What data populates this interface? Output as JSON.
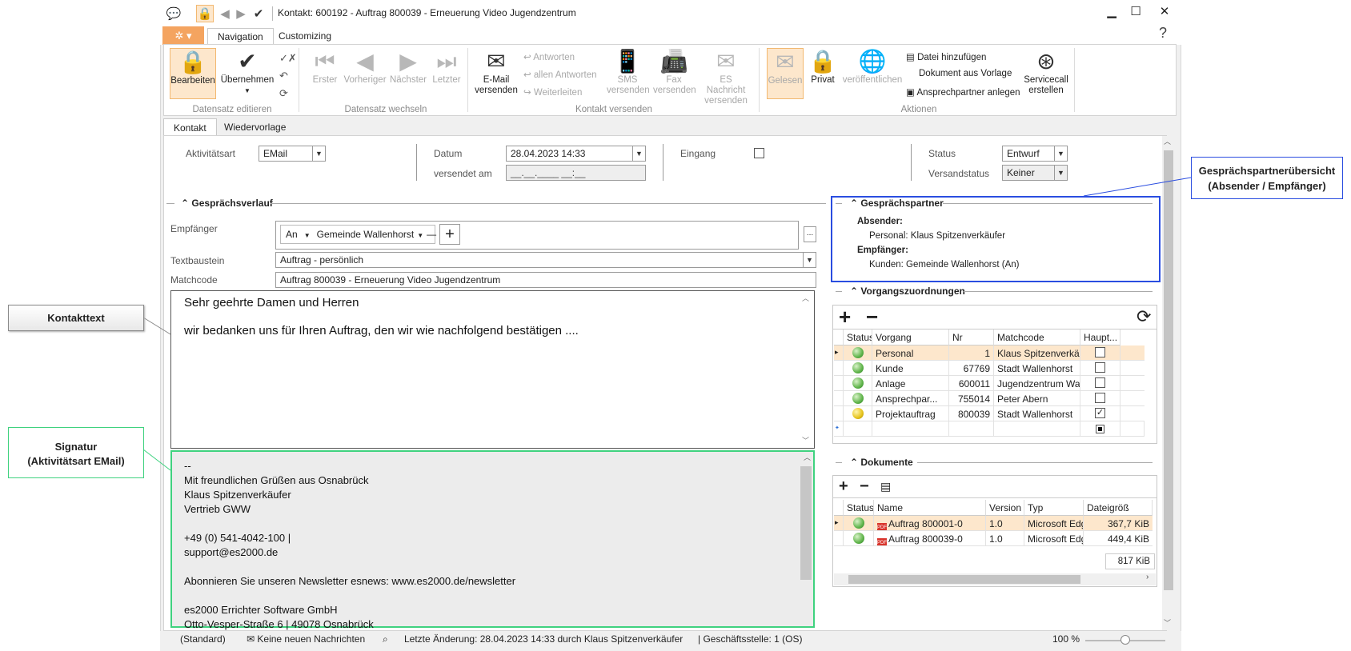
{
  "window": {
    "title": "Kontakt: 600192 - Auftrag 800039 - Erneuerung Video Jugendzentrum",
    "controls": {
      "minimize": "▁",
      "maximize": "☐",
      "close": "✕"
    }
  },
  "ribbon": {
    "tabs": [
      "Navigation",
      "Customizing"
    ],
    "help": "?",
    "groups": {
      "edit": {
        "label": "Datensatz editieren",
        "bearbeiten": "Bearbeiten",
        "uebernehmen": "Übernehmen"
      },
      "nav": {
        "label": "Datensatz wechseln",
        "erster": "Erster",
        "vorheriger": "Vorheriger",
        "naechster": "Nächster",
        "letzter": "Letzter"
      },
      "send": {
        "label": "Kontakt versenden",
        "email_line1": "E-Mail",
        "email_line2": "versenden",
        "antworten": "Antworten",
        "allen_antworten": "allen Antworten",
        "weiterleiten": "Weiterleiten",
        "sms_line1": "SMS",
        "sms_line2": "versenden",
        "fax_line1": "Fax",
        "fax_line2": "versenden",
        "es_line1": "ES Nachricht",
        "es_line2": "versenden"
      },
      "actions": {
        "label": "Aktionen",
        "gelesen": "Gelesen",
        "privat": "Privat",
        "veroeffentlichen": "veröffentlichen",
        "datei_hinzufuegen": "Datei hinzufügen",
        "dokument_aus_vorlage": "Dokument aus Vorlage",
        "ansprechpartner_anlegen": "Ansprechpartner anlegen",
        "servicecall_line1": "Servicecall",
        "servicecall_line2": "erstellen"
      }
    }
  },
  "content_tabs": [
    "Kontakt",
    "Wiedervorlage"
  ],
  "form": {
    "aktivitaetsart_label": "Aktivitätsart",
    "aktivitaetsart_value": "EMail",
    "datum_label": "Datum",
    "datum_value": "28.04.2023 14:33",
    "versendet_label": "versendet am",
    "versendet_value": "__.__.____ __:__",
    "eingang_label": "Eingang",
    "status_label": "Status",
    "status_value": "Entwurf",
    "versandstatus_label": "Versandstatus",
    "versandstatus_value": "Keiner"
  },
  "verlauf": {
    "section_title": "Gesprächsverlauf",
    "empfaenger_label": "Empfänger",
    "empfaenger_type": "An",
    "empfaenger_value": "Gemeinde Wallenhorst",
    "more_btn": "...",
    "textbaustein_label": "Textbaustein",
    "textbaustein_value": "Auftrag - persönlich",
    "matchcode_label": "Matchcode",
    "matchcode_value": "Auftrag 800039 - Erneuerung Video Jugendzentrum",
    "body_line1": "Sehr geehrte Damen und Herren",
    "body_line2": "wir bedanken uns für Ihren Auftrag, den wir wie nachfolgend bestätigen ....",
    "signature": [
      "--",
      "Mit freundlichen Grüßen aus Osnabrück",
      "Klaus Spitzenverkäufer",
      "Vertrieb GWW",
      "",
      "+49 (0) 541-4042-100 |",
      "support@es2000.de",
      "",
      "Abonnieren Sie unseren Newsletter esnews: www.es2000.de/newsletter",
      "",
      "es2000 Errichter Software GmbH",
      "Otto-Vesper-Straße 6 | 49078 Osnabrück"
    ]
  },
  "partner": {
    "section_title": "Gesprächspartner",
    "absender_label": "Absender:",
    "absender_value": "Personal: Klaus Spitzenverkäufer",
    "empfaenger_label": "Empfänger:",
    "empfaenger_value": "Kunden: Gemeinde Wallenhorst (An)"
  },
  "vorgaenge": {
    "section_title": "Vorgangszuordnungen",
    "columns": [
      "Status",
      "Vorgang",
      "Nr",
      "Matchcode",
      "Haupt..."
    ],
    "rows": [
      {
        "status": "green",
        "vorgang": "Personal",
        "nr": "1",
        "matchcode": "Klaus Spitzenverkäufer",
        "haupt": ""
      },
      {
        "status": "green",
        "vorgang": "Kunde",
        "nr": "67769",
        "matchcode": "Stadt Wallenhorst",
        "haupt": ""
      },
      {
        "status": "green",
        "vorgang": "Anlage",
        "nr": "600011",
        "matchcode": "Jugendzentrum Wall...",
        "haupt": ""
      },
      {
        "status": "green",
        "vorgang": "Ansprechpar...",
        "nr": "755014",
        "matchcode": "Peter Abern",
        "haupt": ""
      },
      {
        "status": "yellow",
        "vorgang": "Projektauftrag",
        "nr": "800039",
        "matchcode": "Stadt Wallenhorst",
        "haupt": "✓"
      }
    ]
  },
  "dokumente": {
    "section_title": "Dokumente",
    "columns": [
      "Status",
      "Name",
      "Version",
      "Typ",
      "Dateigröß"
    ],
    "rows": [
      {
        "status": "green",
        "name": "Auftrag 800001-0",
        "version": "1.0",
        "typ": "Microsoft Edge P",
        "size": "367,7 KiB"
      },
      {
        "status": "green",
        "name": "Auftrag 800039-0",
        "version": "1.0",
        "typ": "Microsoft Edge P",
        "size": "449,4 KiB"
      }
    ],
    "total": "817 KiB"
  },
  "statusbar": {
    "standard": "(Standard)",
    "messages": "Keine neuen Nachrichten",
    "last_change": "Letzte Änderung: 28.04.2023 14:33 durch Klaus Spitzenverkäufer",
    "branch": "| Geschäftsstelle:  1 (OS)",
    "zoom": "100 %"
  },
  "callouts": {
    "kontakttext": "Kontakttext",
    "signatur_line1": "Signatur",
    "signatur_line2": "(Aktivitätsart EMail)",
    "partner_line1": "Gesprächspartnerübersicht",
    "partner_line2": "(Absender / Empfänger)"
  }
}
